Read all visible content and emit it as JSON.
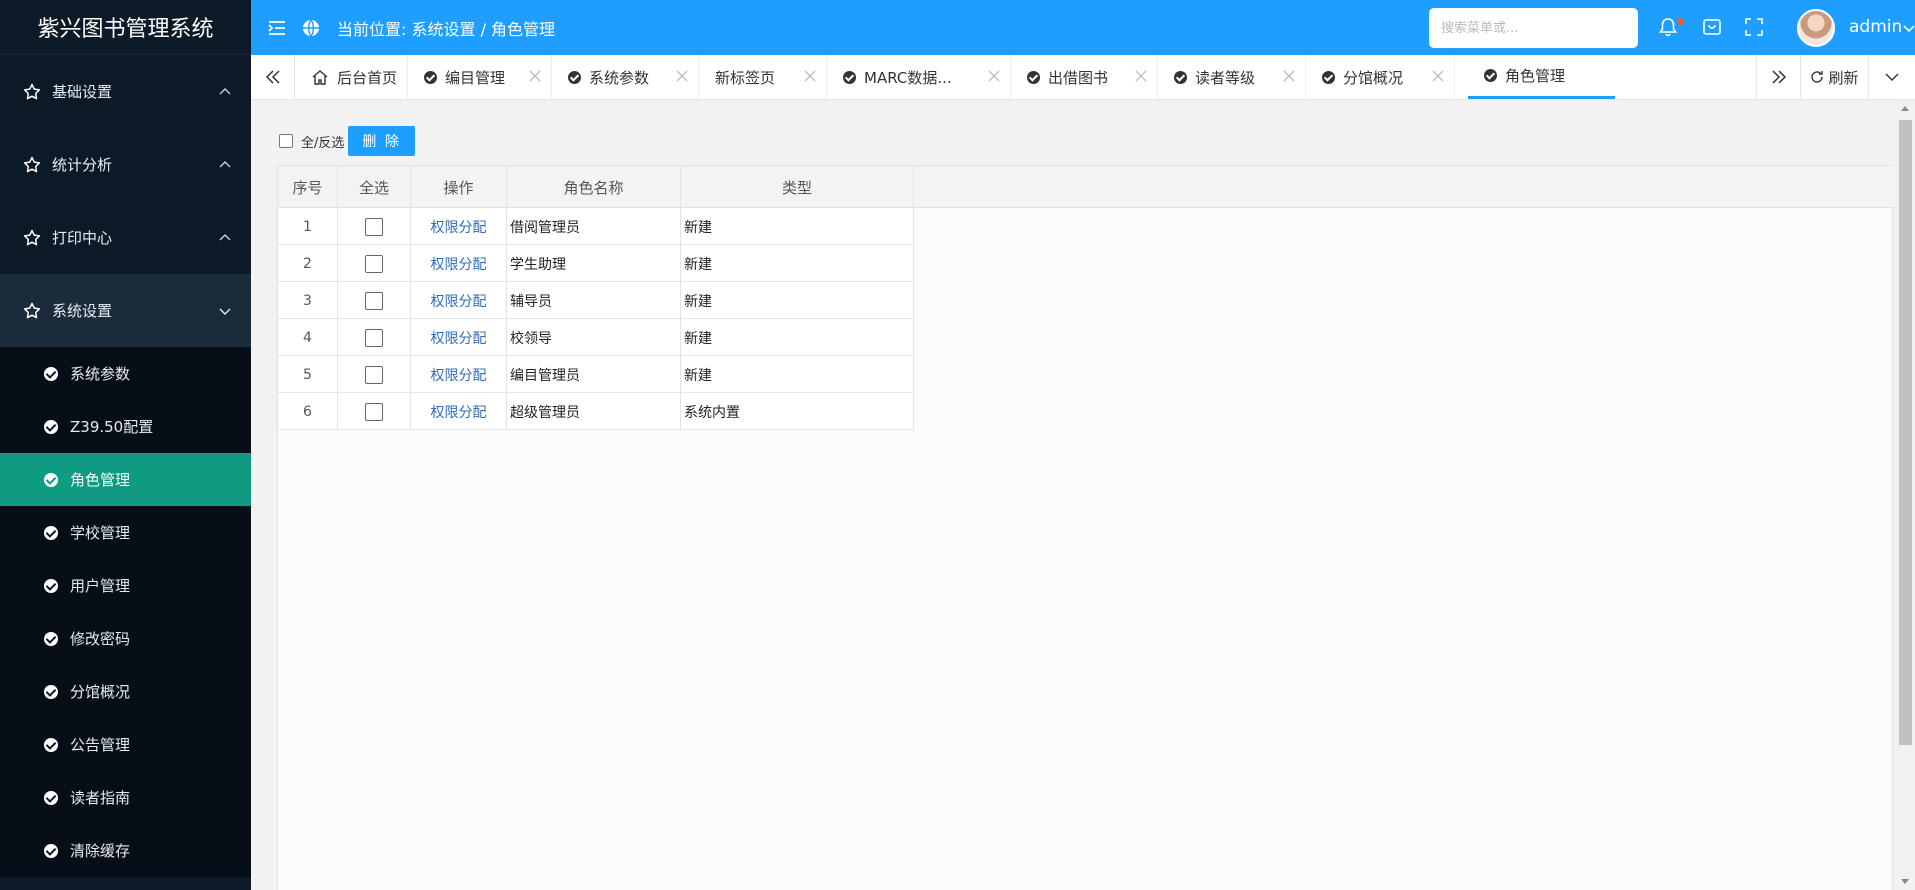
{
  "app": {
    "title": "紫兴图书管理系统"
  },
  "sidebar": {
    "groups": [
      {
        "label": "基础设置",
        "icon": "star-icon",
        "expanded": false
      },
      {
        "label": "统计分析",
        "icon": "star-icon",
        "expanded": false
      },
      {
        "label": "打印中心",
        "icon": "star-icon",
        "expanded": false
      },
      {
        "label": "系统设置",
        "icon": "star-icon",
        "expanded": true
      }
    ],
    "items": [
      {
        "label": "系统参数"
      },
      {
        "label": "Z39.50配置"
      },
      {
        "label": "角色管理",
        "active": true
      },
      {
        "label": "学校管理"
      },
      {
        "label": "用户管理"
      },
      {
        "label": "修改密码"
      },
      {
        "label": "分馆概况"
      },
      {
        "label": "公告管理"
      },
      {
        "label": "读者指南"
      },
      {
        "label": "清除缓存"
      }
    ]
  },
  "header": {
    "breadcrumb": "当前位置: 系统设置 / 角色管理",
    "search_placeholder": "搜索菜单或...",
    "username": "admin",
    "accent": "#1e9fff",
    "notification_dot_color": "#ff5722"
  },
  "tabs": [
    {
      "label": "后台首页",
      "icon": "home-icon",
      "closable": false
    },
    {
      "label": "编目管理",
      "closable": true
    },
    {
      "label": "系统参数",
      "closable": true
    },
    {
      "label": "新标签页",
      "closable": true
    },
    {
      "label": "MARC数据...",
      "closable": true
    },
    {
      "label": "出借图书",
      "closable": true
    },
    {
      "label": "读者等级",
      "closable": true
    },
    {
      "label": "分馆概况",
      "closable": true
    },
    {
      "label": "角色管理",
      "closable": false,
      "active": true
    }
  ],
  "tab_controls": {
    "refresh": "刷新"
  },
  "toolbar": {
    "select_all_label": "全/反选",
    "delete_label": "删 除"
  },
  "table": {
    "columns": [
      "序号",
      "全选",
      "操作",
      "角色名称",
      "类型"
    ],
    "rows": [
      {
        "no": "1",
        "action": "权限分配",
        "name": "借阅管理员",
        "type": "新建"
      },
      {
        "no": "2",
        "action": "权限分配",
        "name": "学生助理",
        "type": "新建"
      },
      {
        "no": "3",
        "action": "权限分配",
        "name": "辅导员",
        "type": "新建"
      },
      {
        "no": "4",
        "action": "权限分配",
        "name": "校领导",
        "type": "新建"
      },
      {
        "no": "5",
        "action": "权限分配",
        "name": "编目管理员",
        "type": "新建"
      },
      {
        "no": "6",
        "action": "权限分配",
        "name": "超级管理员",
        "type": "系统内置"
      }
    ]
  }
}
